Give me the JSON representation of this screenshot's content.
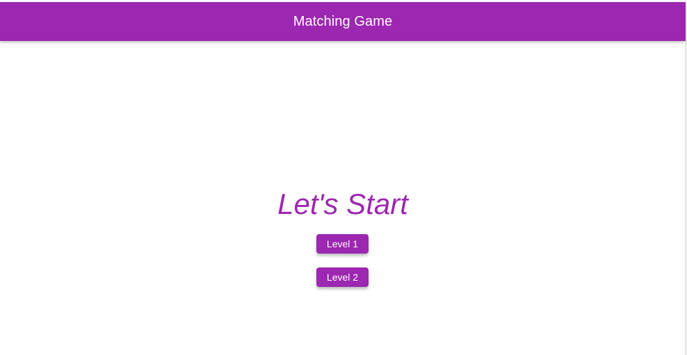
{
  "app_bar": {
    "title": "Matching Game",
    "color": "#9c27b0"
  },
  "main": {
    "heading": "Let's Start",
    "levels": [
      {
        "label": "Level 1"
      },
      {
        "label": "Level 2"
      }
    ]
  }
}
